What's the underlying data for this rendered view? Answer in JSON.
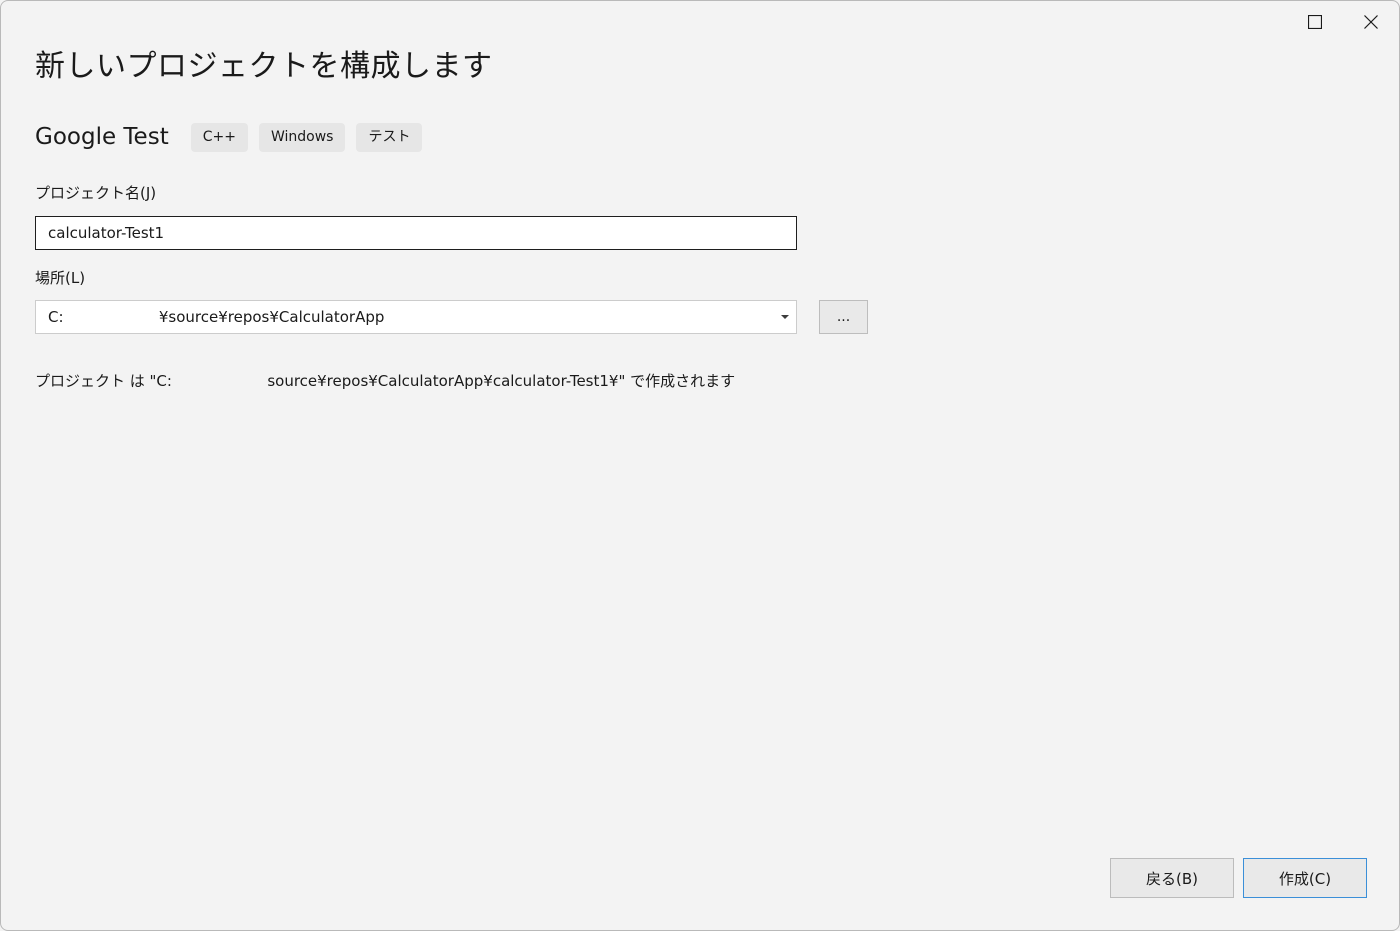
{
  "window": {
    "maximize_icon": "maximize-icon",
    "close_icon": "close-icon"
  },
  "page": {
    "title": "新しいプロジェクトを構成します"
  },
  "template": {
    "name": "Google Test",
    "tags": [
      "C++",
      "Windows",
      "テスト"
    ]
  },
  "project_name": {
    "label": "プロジェクト名(J)",
    "value": "calculator-Test1"
  },
  "location": {
    "label": "場所(L)",
    "value": "C:                    ¥source¥repos¥CalculatorApp",
    "browse_label": "...",
    "dropdown_icon": "caret-down-icon"
  },
  "path_note": "プロジェクト は \"C:                    source¥repos¥CalculatorApp¥calculator-Test1¥\" で作成されます",
  "footer": {
    "back_label": "戻る(B)",
    "create_label": "作成(C)"
  },
  "colors": {
    "background": "#f3f3f3",
    "accent_border": "#3b8fd8",
    "tag_background": "#e6e6e6"
  }
}
